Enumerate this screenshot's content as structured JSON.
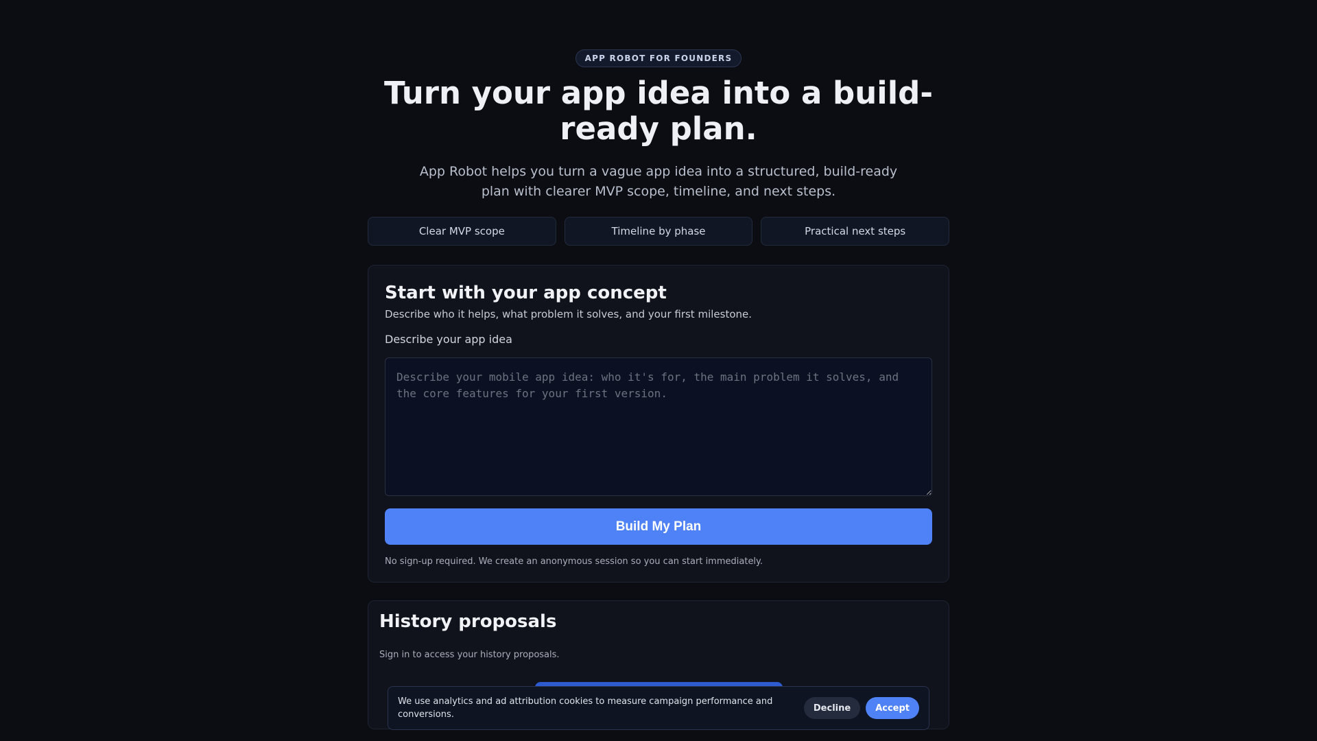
{
  "hero": {
    "eyebrow": "APP ROBOT FOR FOUNDERS",
    "title": "Turn your app idea into a build-ready plan.",
    "subtitle": "App Robot helps you turn a vague app idea into a structured, build-ready plan with clearer MVP scope, timeline, and next steps."
  },
  "features": [
    {
      "label": "Clear MVP scope"
    },
    {
      "label": "Timeline by phase"
    },
    {
      "label": "Practical next steps"
    }
  ],
  "concept": {
    "title": "Start with your app concept",
    "description": "Describe who it helps, what problem it solves, and your first milestone.",
    "field_label": "Describe your app idea",
    "placeholder": "Describe your mobile app idea: who it's for, the main problem it solves, and the core features for your first version.",
    "value": "",
    "button_label": "Build My Plan",
    "note": "No sign-up required. We create an anonymous session so you can start immediately."
  },
  "history": {
    "title": "History proposals",
    "note": "Sign in to access your history proposals."
  },
  "cookie_banner": {
    "message": "We use analytics and ad attribution cookies to measure campaign performance and conversions.",
    "decline_label": "Decline",
    "accept_label": "Accept"
  },
  "colors": {
    "background": "#0b0d12",
    "card": "#10131b",
    "accent": "#4f82f7"
  }
}
